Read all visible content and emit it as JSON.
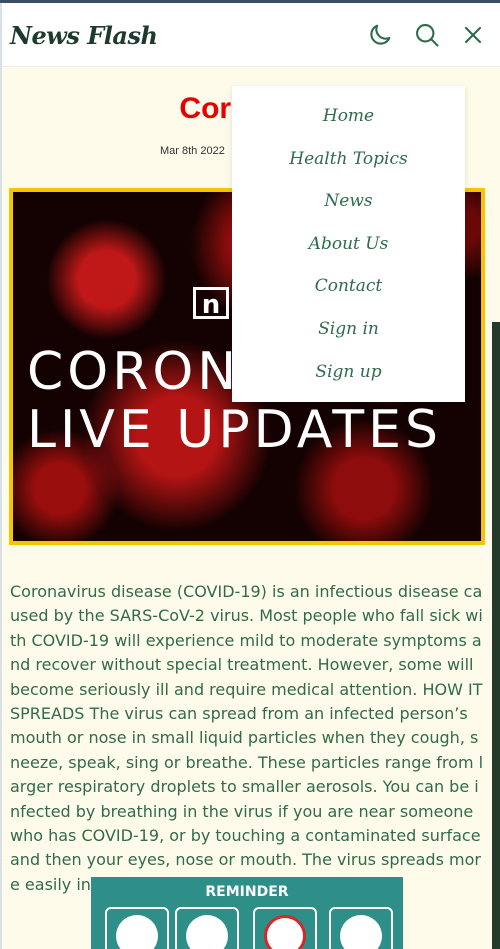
{
  "header": {
    "logo": "News Flash",
    "icons": {
      "theme": "moon-icon",
      "search": "search-icon",
      "close": "close-icon"
    }
  },
  "article": {
    "title": "Corona Vi",
    "date": "Mar 8th 2022",
    "hero": {
      "badge": "n",
      "line1": "CORONA",
      "line2": "LIVE UPDATES"
    },
    "body": "Coronavirus disease (COVID-19) is an infectious disease caused by the SARS-CoV-2 virus. Most people who fall sick with COVID-19 will experience mild to moderate symptoms and recover without special treatment. However, some will become seriously ill and require medical attention. HOW IT SPREADS The virus can spread from an infected person’s mouth or nose in small liquid particles when they cough, sneeze, speak, sing or breathe. These particles range from larger respiratory droplets to smaller aerosols. You can be infected by breathing in the virus if you are near someone who has COVID-19, or by touching a contaminated surface and then your eyes, nose or mouth. The virus spreads more easily indoors and in crowded settings.",
    "reminder": {
      "title": "REMINDER"
    }
  },
  "menu": {
    "items": [
      "Home",
      "Health Topics",
      "News",
      "About Us",
      "Contact",
      "Sign in",
      "Sign up"
    ]
  },
  "colors": {
    "accent": "#2f6b4c",
    "title": "#e60000",
    "background": "#fffbea",
    "hero_border": "#f7c400"
  }
}
